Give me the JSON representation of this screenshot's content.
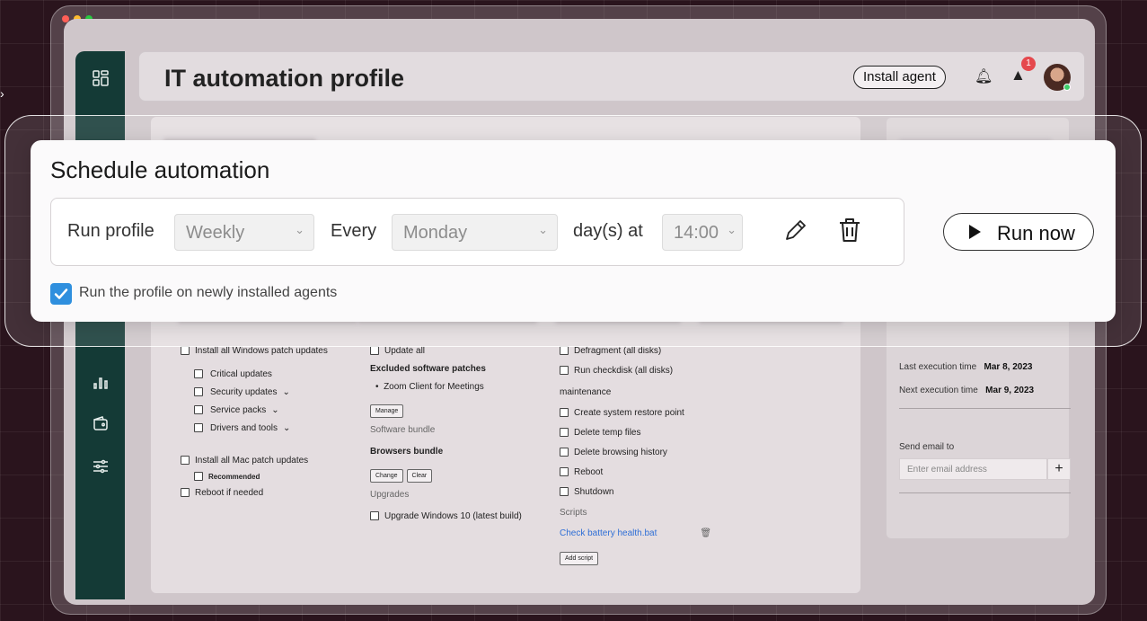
{
  "app": {
    "title": "IT automation profile",
    "install_agent": "Install agent",
    "alert_count": "1",
    "colors": {
      "sidebar": "#143a36",
      "accent": "#2f8fde",
      "link": "#2f6fd6",
      "badge": "#e5484d"
    }
  },
  "sidebar": {
    "icons": [
      "grid-icon",
      "chart-icon",
      "wallet-icon",
      "sliders-icon"
    ]
  },
  "schedule": {
    "title": "Schedule automation",
    "run_profile_label": "Run profile",
    "frequency": "Weekly",
    "every_label": "Every",
    "day": "Monday",
    "days_at_label": "day(s) at",
    "time": "14:00",
    "run_now": "Run now",
    "run_new_agents_label": "Run the profile on newly installed agents",
    "run_new_agents_checked": true
  },
  "windows_col": {
    "header": "Install all Windows patch updates",
    "items": [
      "Critical updates",
      "Security updates",
      "Service packs",
      "Drivers and tools"
    ],
    "mac": "Install all Mac patch updates",
    "recommended": "Recommended",
    "reboot": "Reboot if needed"
  },
  "software_col": {
    "update_all": "Update all",
    "excluded_title": "Excluded software patches",
    "excluded_item": "Zoom Client for Meetings",
    "manage": "Manage",
    "bundle_label": "Software bundle",
    "bundle_name": "Browsers bundle",
    "change": "Change",
    "clear": "Clear",
    "upgrades_label": "Upgrades",
    "upgrade_item": "Upgrade Windows 10 (latest build)"
  },
  "maintenance_col": {
    "defrag": "Defragment (all disks)",
    "checkdisk": "Run checkdisk (all disks)",
    "maintenance_title": "maintenance",
    "items": [
      "Create system restore point",
      "Delete temp files",
      "Delete browsing history",
      "Reboot",
      "Shutdown"
    ],
    "scripts_label": "Scripts",
    "script_name": "Check battery health.bat",
    "add_script": "Add script"
  },
  "right_panel": {
    "last_exec_label": "Last execution time",
    "last_exec_value": "Mar 8, 2023",
    "next_exec_label": "Next execution time",
    "next_exec_value": "Mar 9, 2023",
    "send_email_label": "Send email to",
    "email_placeholder": "Enter email address"
  }
}
